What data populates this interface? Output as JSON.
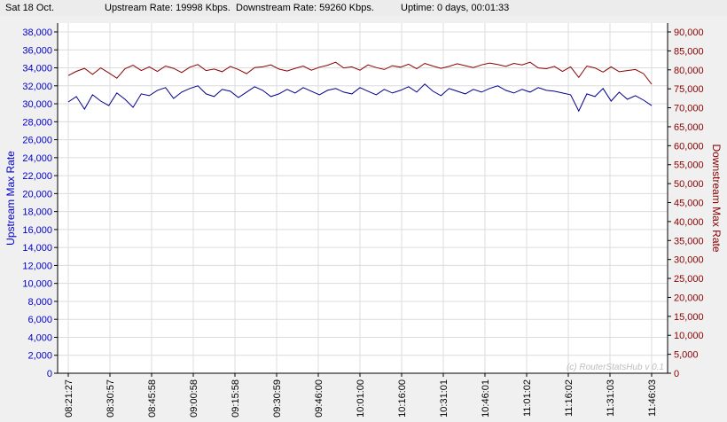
{
  "status": {
    "date": "Sat 18 Oct.",
    "upstream": "Upstream Rate: 19998 Kbps.",
    "downstream": "Downstream Rate: 59260 Kbps.",
    "uptime": "Uptime: 0 days, 00:01:33"
  },
  "watermark": "(c) RouterStatsHub v 0.1",
  "colors": {
    "upstream": "#00008b",
    "downstream": "#8b0000",
    "grid": "#dcdcdc",
    "background": "#ffffff"
  },
  "chart_data": {
    "type": "line",
    "grid": true,
    "xlabel": "",
    "x_ticks": [
      "08:21:27",
      "08:30:57",
      "08:45:58",
      "09:00:58",
      "09:15:58",
      "09:30:59",
      "09:46:00",
      "10:01:00",
      "10:16:00",
      "10:31:01",
      "10:46:01",
      "11:01:02",
      "11:16:02",
      "11:31:03",
      "11:46:03"
    ],
    "x_range": [
      0,
      106
    ],
    "x_tick_positions": [
      0,
      6,
      16,
      26,
      36,
      46,
      56,
      66,
      76,
      86,
      96,
      106,
      116,
      126,
      136
    ],
    "y_left": {
      "label": "Upstream Max Rate",
      "ylim": [
        0,
        38000
      ],
      "ticks": [
        "0",
        "2,000",
        "4,000",
        "6,000",
        "8,000",
        "10,000",
        "12,000",
        "14,000",
        "16,000",
        "18,000",
        "20,000",
        "22,000",
        "24,000",
        "26,000",
        "28,000",
        "30,000",
        "32,000",
        "34,000",
        "36,000",
        "38,000"
      ]
    },
    "y_right": {
      "label": "Downstream Max Rate",
      "ylim": [
        0,
        90000
      ],
      "ticks": [
        "0",
        "5,000",
        "10,000",
        "15,000",
        "20,000",
        "25,000",
        "30,000",
        "35,000",
        "40,000",
        "45,000",
        "50,000",
        "55,000",
        "60,000",
        "65,000",
        "70,000",
        "75,000",
        "80,000",
        "85,000",
        "90,000"
      ]
    },
    "series": [
      {
        "name": "Upstream Max Rate",
        "axis": "left",
        "x": [
          0,
          2,
          4,
          6,
          8,
          10,
          12,
          14,
          16,
          18,
          20,
          22,
          24,
          26,
          28,
          30,
          32,
          34,
          36,
          38,
          40,
          42,
          44,
          46,
          48,
          50,
          52,
          54,
          56,
          58,
          60,
          62,
          64,
          66,
          68,
          70,
          72,
          74,
          76,
          78,
          80,
          82,
          84,
          86,
          88,
          90,
          92,
          94,
          96,
          98,
          100,
          102,
          104,
          106,
          108,
          110,
          112,
          114,
          116,
          118,
          120,
          122,
          124,
          126,
          128,
          130,
          132,
          134,
          136,
          138,
          140,
          142,
          144
        ],
        "values": [
          30200,
          30800,
          29400,
          31000,
          30300,
          29800,
          31200,
          30500,
          29600,
          31100,
          30900,
          31500,
          31800,
          30600,
          31300,
          31700,
          32000,
          31100,
          30800,
          31600,
          31400,
          30700,
          31300,
          31900,
          31500,
          30800,
          31100,
          31600,
          31200,
          31800,
          31400,
          31000,
          31500,
          31700,
          31300,
          31100,
          31800,
          31400,
          31000,
          31600,
          31200,
          31500,
          31900,
          31300,
          32200,
          31400,
          30900,
          31700,
          31400,
          31100,
          31600,
          31300,
          31700,
          32000,
          31500,
          31200,
          31600,
          31300,
          31800,
          31500,
          31400,
          31200,
          31000,
          29200,
          31100,
          30800,
          31700,
          30300,
          31300,
          30500,
          30900,
          30400,
          29800
        ]
      },
      {
        "name": "Downstream Max Rate",
        "axis": "right",
        "x": [
          0,
          2,
          4,
          6,
          8,
          10,
          12,
          14,
          16,
          18,
          20,
          22,
          24,
          26,
          28,
          30,
          32,
          34,
          36,
          38,
          40,
          42,
          44,
          46,
          48,
          50,
          52,
          54,
          56,
          58,
          60,
          62,
          64,
          66,
          68,
          70,
          72,
          74,
          76,
          78,
          80,
          82,
          84,
          86,
          88,
          90,
          92,
          94,
          96,
          98,
          100,
          102,
          104,
          106,
          108,
          110,
          112,
          114,
          116,
          118,
          120,
          122,
          124,
          126,
          128,
          130,
          132,
          134,
          136,
          138,
          140,
          142,
          144
        ],
        "values": [
          78500,
          79600,
          80400,
          78800,
          80500,
          79200,
          77800,
          80300,
          81200,
          79800,
          80800,
          79600,
          81000,
          80400,
          79300,
          80700,
          81400,
          79800,
          80200,
          79500,
          80900,
          80100,
          79000,
          80600,
          80800,
          81300,
          80200,
          79700,
          80400,
          81000,
          79900,
          80700,
          81200,
          82000,
          80500,
          80800,
          79900,
          81300,
          80600,
          80100,
          81100,
          80700,
          81500,
          80300,
          81700,
          81000,
          80400,
          80900,
          81600,
          81100,
          80600,
          81300,
          81800,
          81400,
          80900,
          81700,
          81300,
          82000,
          80500,
          80300,
          80900,
          79600,
          80800,
          78000,
          81000,
          80500,
          79400,
          80800,
          79500,
          79800,
          80100,
          79000,
          76200
        ]
      }
    ]
  }
}
